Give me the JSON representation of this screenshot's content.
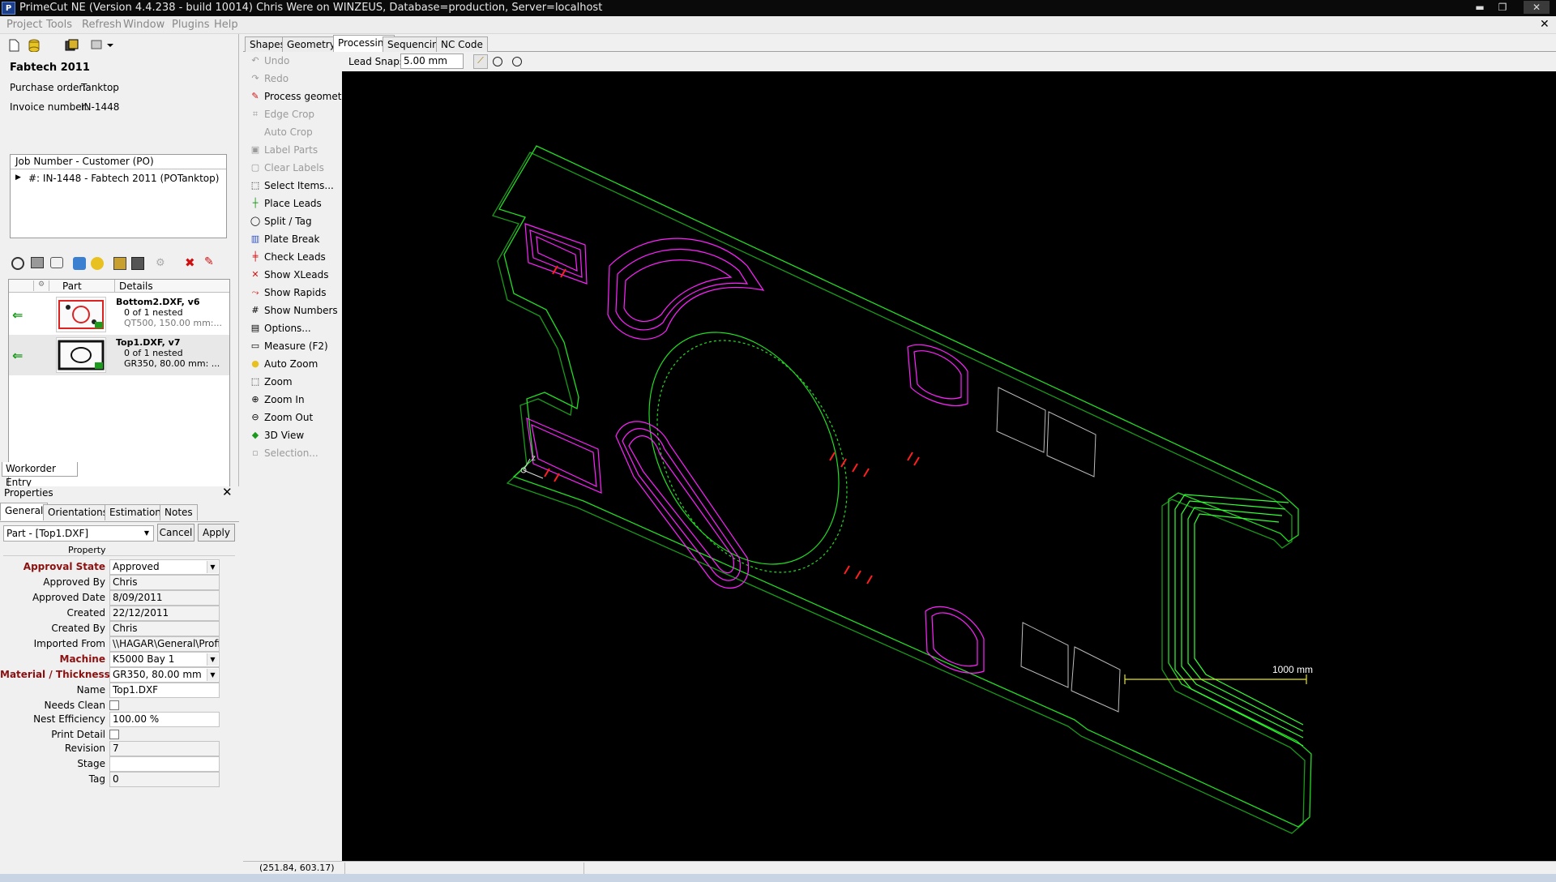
{
  "app": {
    "title": "PrimeCut NE (Version 4.4.238 - build 10014)  Chris Were on WINZEUS, Database=production, Server=localhost",
    "logo_text": "P",
    "close_symbol": "✕"
  },
  "menu": [
    "Project",
    "Tools",
    "Refresh",
    "Window",
    "Plugins",
    "Help"
  ],
  "workorder": {
    "company": "Fabtech 2011",
    "purchase_order_label": "Purchase order:",
    "purchase_order": "Tanktop",
    "invoice_label": "Invoice number:",
    "invoice": "IN-1448",
    "tree_header": "Job Number - Customer (PO)",
    "tree_item": "#: IN-1448 - Fabtech 2011 (POTanktop)",
    "tab_label": "Workorder Entry"
  },
  "parts": {
    "columns": [
      "Part",
      "Details"
    ],
    "rows": [
      {
        "name": "Bottom2.DXF, v6",
        "nested": "0 of 1 nested",
        "material": "QT500, 150.00 mm:..."
      },
      {
        "name": "Top1.DXF, v7",
        "nested": "0 of 1 nested",
        "material": "GR350, 80.00 mm: ..."
      }
    ]
  },
  "properties": {
    "title": "Properties",
    "tabs": [
      "General",
      "Orientations",
      "Estimation",
      "Notes"
    ],
    "selector": "Part - [Top1.DXF]",
    "cancel": "Cancel",
    "apply": "Apply",
    "column_header": "Property",
    "fields": [
      {
        "label": "Approval State",
        "value": "Approved",
        "bold": true,
        "dropdown": true
      },
      {
        "label": "Approved By",
        "value": "Chris"
      },
      {
        "label": "Approved Date",
        "value": "8/09/2011"
      },
      {
        "label": "Created",
        "value": "22/12/2011"
      },
      {
        "label": "Created By",
        "value": "Chris"
      },
      {
        "label": "Imported From",
        "value": "\\\\HAGAR\\General\\Profile"
      },
      {
        "label": "Machine",
        "value": "K5000 Bay 1",
        "bold": true,
        "dropdown": true
      },
      {
        "label": "Material / Thickness",
        "value": "GR350, 80.00 mm",
        "bold": true,
        "dropdown": true
      },
      {
        "label": "Name",
        "value": "Top1.DXF",
        "white": true
      },
      {
        "label": "Needs Clean",
        "checkbox": true
      },
      {
        "label": "Nest Efficiency",
        "value": "100.00 %",
        "white": true
      },
      {
        "label": "Print Detail",
        "checkbox": true
      },
      {
        "label": "Revision",
        "value": "7"
      },
      {
        "label": "Stage",
        "value": "",
        "white": true
      },
      {
        "label": "Tag",
        "value": "0"
      }
    ]
  },
  "main_tabs": [
    "Shapes",
    "Geometry",
    "Processing",
    "Sequencing",
    "NC Code"
  ],
  "active_main_tab": "Processing",
  "lead_snaps": {
    "label": "Lead Snaps",
    "value": "5.00 mm"
  },
  "commands": [
    {
      "label": "Undo",
      "enabled": false,
      "icon": "undo-icon"
    },
    {
      "label": "Redo",
      "enabled": false,
      "icon": "redo-icon"
    },
    {
      "label": "Process geometry",
      "enabled": true,
      "icon": "wrench-icon"
    },
    {
      "label": "Edge Crop",
      "enabled": false,
      "icon": "edge-crop-icon"
    },
    {
      "label": "Auto Crop",
      "enabled": false,
      "icon": ""
    },
    {
      "label": "Label Parts",
      "enabled": false,
      "icon": "label-icon"
    },
    {
      "label": "Clear Labels",
      "enabled": false,
      "icon": "clear-labels-icon"
    },
    {
      "label": "Select Items...",
      "enabled": true,
      "icon": "select-icon"
    },
    {
      "label": "Place Leads",
      "enabled": true,
      "icon": "place-leads-icon"
    },
    {
      "label": "Split / Tag",
      "enabled": true,
      "icon": "split-icon"
    },
    {
      "label": "Plate Break",
      "enabled": true,
      "icon": "plate-break-icon"
    },
    {
      "label": "Check Leads",
      "enabled": true,
      "icon": "check-leads-icon"
    },
    {
      "label": "Show XLeads",
      "enabled": true,
      "icon": "xleads-icon"
    },
    {
      "label": "Show Rapids",
      "enabled": true,
      "icon": "rapids-icon"
    },
    {
      "label": "Show Numbers",
      "enabled": true,
      "icon": "numbers-icon"
    },
    {
      "label": "Options...",
      "enabled": true,
      "icon": "options-icon"
    },
    {
      "label": "Measure (F2)",
      "enabled": true,
      "icon": "ruler-icon"
    },
    {
      "label": "Auto Zoom",
      "enabled": true,
      "icon": "bulb-icon"
    },
    {
      "label": "Zoom",
      "enabled": true,
      "icon": "zoom-icon"
    },
    {
      "label": "Zoom In",
      "enabled": true,
      "icon": "zoom-in-icon"
    },
    {
      "label": "Zoom Out",
      "enabled": true,
      "icon": "zoom-out-icon"
    },
    {
      "label": "3D View",
      "enabled": true,
      "icon": "3d-view-icon"
    },
    {
      "label": "Selection...",
      "enabled": false,
      "icon": "selection-icon"
    }
  ],
  "viewport": {
    "scale_label": "1000 mm",
    "axis_label": "z",
    "colors": {
      "outline": "#22dd22",
      "toolpath": "#ff22ff",
      "lead": "#ff2020",
      "scale": "#e8e820",
      "hole": "#bbbbbb"
    }
  },
  "status": {
    "coordinates": "(251.84, 603.17)"
  }
}
